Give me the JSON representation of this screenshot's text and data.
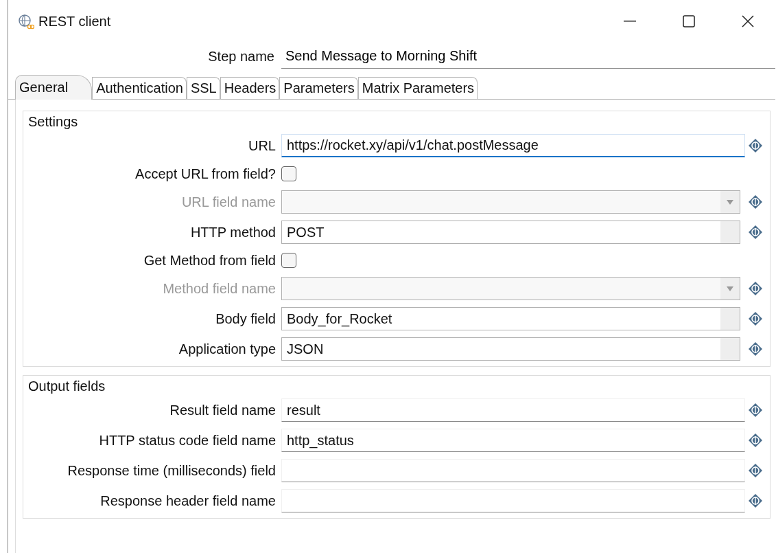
{
  "window": {
    "title": "REST client"
  },
  "step_name": {
    "label": "Step name",
    "value": "Send Message to Morning Shift"
  },
  "tabs": [
    {
      "label": "General",
      "selected": true
    },
    {
      "label": "Authentication",
      "selected": false
    },
    {
      "label": "SSL",
      "selected": false
    },
    {
      "label": "Headers",
      "selected": false
    },
    {
      "label": "Parameters",
      "selected": false
    },
    {
      "label": "Matrix Parameters",
      "selected": false
    }
  ],
  "settings": {
    "title": "Settings",
    "rows": [
      {
        "kind": "text",
        "label": "URL",
        "value": "https://rocket.xy/api/v1/chat.postMessage",
        "focused": true,
        "disabled": false
      },
      {
        "kind": "checkbox",
        "label": "Accept URL from field?",
        "checked": false,
        "focused": false,
        "disabled": false
      },
      {
        "kind": "combo",
        "label": "URL field name",
        "focused": false,
        "disabled": true
      },
      {
        "kind": "select",
        "label": "HTTP method",
        "value": "POST",
        "focused": false,
        "disabled": false
      },
      {
        "kind": "checkbox",
        "label": "Get Method from field",
        "checked": false,
        "focused": false,
        "disabled": false
      },
      {
        "kind": "combo",
        "label": "Method field name",
        "focused": false,
        "disabled": true
      },
      {
        "kind": "select",
        "label": "Body field",
        "value": "Body_for_Rocket",
        "focused": false,
        "disabled": false
      },
      {
        "kind": "select",
        "label": "Application type",
        "value": "JSON",
        "focused": false,
        "disabled": false
      }
    ]
  },
  "output_fields": {
    "title": "Output fields",
    "rows": [
      {
        "kind": "text",
        "label": "Result field name",
        "value": "result"
      },
      {
        "kind": "text",
        "label": "HTTP status code field name",
        "value": "http_status"
      },
      {
        "kind": "text",
        "label": "Response time (milliseconds) field"
      },
      {
        "kind": "text",
        "label": "Response header field name"
      }
    ]
  }
}
